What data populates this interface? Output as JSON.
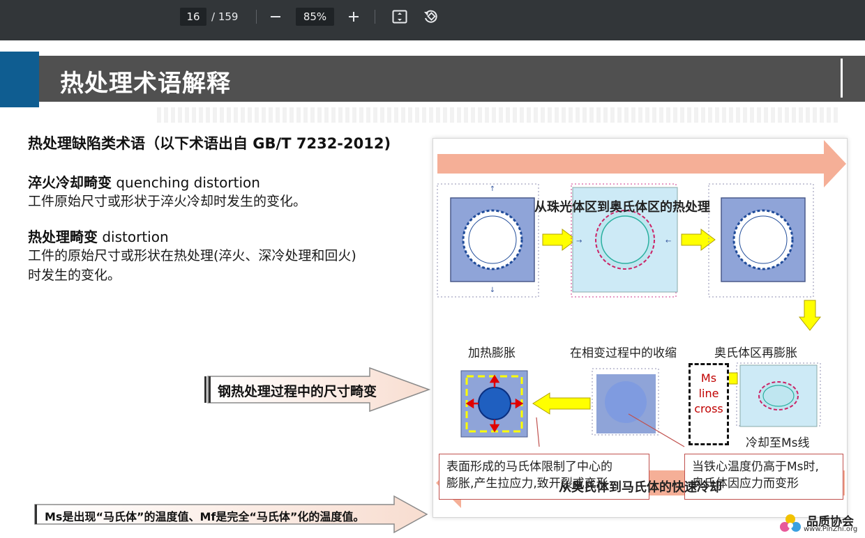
{
  "toolbar": {
    "page_current": "16",
    "page_total": "/ 159",
    "zoom": "85%",
    "icons": {
      "zoom_out": "minus-icon",
      "zoom_in": "plus-icon",
      "fit": "fit-page-icon",
      "rotate": "rotate-icon"
    }
  },
  "slide": {
    "title": "热处理术语解释",
    "section_heading": "热处理缺陷类术语（以下术语出自 GB/T 7232-2012)",
    "terms": [
      {
        "name_cn": "淬火冷却畸变",
        "name_en": "quenching distortion",
        "lines": [
          "工件原始尺寸或形状于淬火冷却时发生的变化。"
        ]
      },
      {
        "name_cn": "热处理畸变",
        "name_en": "distortion",
        "lines": [
          "工件的原始尺寸或形状在热处理(淬火、深冷处理和回火)",
          "时发生的变化。"
        ]
      }
    ],
    "callout_main": "钢热处理过程中的尺寸畸变",
    "callout_bottom": "Ms是出现“马氏体”的温度值、Mf是完全“马氏体”化的温度值。"
  },
  "diagram": {
    "top_arrow": "从珠光体区到奥氏体区的热处理",
    "stage_labels": [
      "加热膨胀",
      "在相变过程中的收缩",
      "奥氏体区再膨胀"
    ],
    "ms_box_lines": [
      "Ms",
      "line",
      "cross"
    ],
    "cool_label": "冷却至Ms线",
    "note_left": [
      "表面形成的马氏体限制了中心的",
      "膨胀,产生拉应力,致开裂或变形"
    ],
    "note_right": [
      "当铁心温度仍高于Ms时,",
      "奥氏体因应力而变形"
    ],
    "bottom_arrow": "从奥氏体到马氏体的快速冷却",
    "colors": {
      "arrow_salmon": "#f4a68c",
      "panel_blue": "#8fa4d8",
      "light_cyan": "#cdeaf6",
      "yellow_arrow": "#ffff00",
      "red": "#e00000"
    }
  },
  "brand": {
    "name_cn": "品质协会",
    "url": "www.PinZhi.org"
  }
}
